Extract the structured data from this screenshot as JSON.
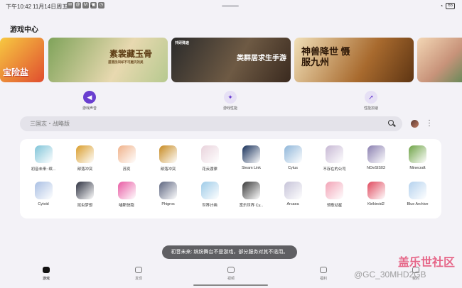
{
  "status": {
    "time": "下午10:42",
    "date": "11月14日周五",
    "battery": "65",
    "notif_icons": [
      "chat-icon",
      "mail-icon",
      "m-icon",
      "image-icon",
      "clock-icon"
    ]
  },
  "header": {
    "title": "游戏中心"
  },
  "banners": [
    {
      "text": "宝险盐"
    },
    {
      "text": "素裳藏玉骨",
      "subtitle": "遗落民间却不可磨灭的美"
    },
    {
      "tag": "共研殊途",
      "text": "类群居求生手游"
    },
    {
      "text": "神兽降世 慑服九州"
    },
    {
      "text": ""
    }
  ],
  "quick_actions": [
    {
      "label": "游戏声音",
      "icon": "speaker-icon"
    },
    {
      "label": "游戏性能",
      "icon": "gamepad-icon"
    },
    {
      "label": "性能加速",
      "icon": "rocket-icon"
    }
  ],
  "search": {
    "placeholder": "三国志・战略版"
  },
  "apps": [
    {
      "label": "初音未来: 缤...",
      "color": "#7fc4d8"
    },
    {
      "label": "部落冲突",
      "color": "#d99d2b"
    },
    {
      "label": "苏奕",
      "color": "#f0b28a"
    },
    {
      "label": "部落冲突",
      "color": "#c78a21"
    },
    {
      "label": "花云渡律",
      "color": "#e9d3dc"
    },
    {
      "label": "Steam Link",
      "color": "#17305a"
    },
    {
      "label": "Cytus",
      "color": "#8fb6d9"
    },
    {
      "label": "不存在的公司",
      "color": "#c7b8d4"
    },
    {
      "label": "NOeSIS03",
      "color": "#8a7fb0"
    },
    {
      "label": "Minecraft",
      "color": "#6ea346"
    },
    {
      "label": "Cytoid",
      "color": "#a9bfe3"
    },
    {
      "label": "昆虫梦想",
      "color": "#2d3140"
    },
    {
      "label": "喵斯快跑",
      "color": "#e85aa3"
    },
    {
      "label": "Phigros",
      "color": "#5e6680"
    },
    {
      "label": "世界计画",
      "color": "#9ecbe8"
    },
    {
      "label": "宽乐世界 Cy...",
      "color": "#3a3a3a"
    },
    {
      "label": "Arcaea",
      "color": "#c6c3d8"
    },
    {
      "label": "领歌动星",
      "color": "#f2a3b6"
    },
    {
      "label": "Kirikiroid2",
      "color": "#e04a5e"
    },
    {
      "label": "Blue Archive",
      "color": "#b5d2ee"
    }
  ],
  "toast": {
    "text": "初音未来: 缤纷舞台不是游戏，部分服务对其不适用。"
  },
  "nav": [
    {
      "label": "游戏",
      "active": true
    },
    {
      "label": "发现",
      "active": false
    },
    {
      "label": "视频",
      "active": false
    },
    {
      "label": "福利",
      "active": false
    },
    {
      "label": "我的",
      "active": false
    }
  ],
  "watermark": {
    "site": "盖乐世社区",
    "user": "@GC_30MHD2GB"
  }
}
